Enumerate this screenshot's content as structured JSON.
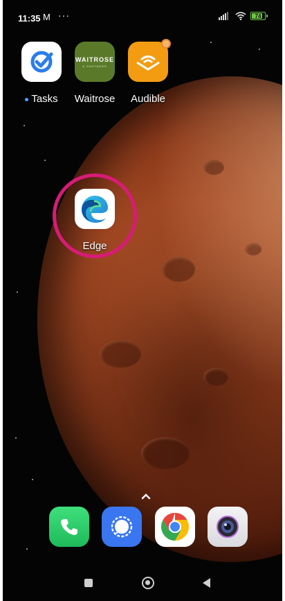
{
  "status_bar": {
    "time": "11:35",
    "mail_icon": "gmail-icon",
    "more_dots": "···",
    "battery_level": "74"
  },
  "apps": [
    {
      "label": "Tasks",
      "icon": "tasks-icon",
      "has_new_dot": true
    },
    {
      "label": "Waitrose",
      "icon": "waitrose-icon",
      "brand_text": "WAITROSE",
      "brand_sub": "& PARTNERS"
    },
    {
      "label": "Audible",
      "icon": "audible-icon",
      "has_notification": true
    },
    {
      "label": "Edge",
      "icon": "edge-icon",
      "highlighted": true
    }
  ],
  "dock": [
    {
      "name": "Phone",
      "icon": "phone-icon"
    },
    {
      "name": "Signal",
      "icon": "signal-icon"
    },
    {
      "name": "Chrome",
      "icon": "chrome-icon"
    },
    {
      "name": "Camera",
      "icon": "camera-icon"
    }
  ],
  "colors": {
    "highlight_ring": "#d81b78",
    "battery": "#6cc644",
    "waitrose_green": "#5a7a2a",
    "audible_orange": "#f39c12"
  }
}
